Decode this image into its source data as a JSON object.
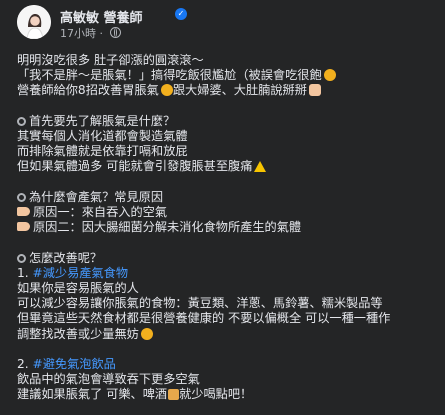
{
  "author": {
    "name": "高敏敏 營養師",
    "verified_icon": "verified-badge-icon",
    "time": "17小時",
    "separator": "·",
    "privacy_icon": "globe-icon"
  },
  "post": {
    "lines": [
      "明明沒吃很多 肚子卻漲的圓滾滾～",
      "「我不是胖～是脹氣！」搞得吃飯很尷尬（被誤會吃很飽",
      "營養師給你8招改善胃脹氣",
      "跟大婦婆、大肚腩說掰掰",
      "首先要先了解脹氣是什麼？",
      "其實每個人消化道都會製造氣體",
      "而排除氣體就是依靠打嗝和放屁",
      "但如果氣體過多 可能就會引發腹脹甚至腹痛",
      "為什麼會產氣？常見原因",
      "原因一：來自吞入的空氣",
      "原因二：因大腸細菌分解未消化食物所產生的氣體",
      "怎麼改善呢？",
      "1. ",
      "#減少易產氣食物",
      "如果你是容易脹氣的人",
      "可以減少容易讓你脹氣的食物：黃豆類、洋蔥、馬鈴薯、糯米製品等",
      "但畢竟這些天然食材都是很營養健康的 不要以偏概全 可以一種一種作",
      "調整找改善或少量無妨",
      "2. ",
      "#避免氣泡飲品",
      "飲品中的氣泡會導致吞下更多空氣",
      "建議如果脹氣了 可樂、啤酒",
      "就少喝點吧！"
    ]
  },
  "icons": {
    "face": "grinning-face-emoji",
    "hand": "waving-hand-emoji",
    "warning": "warning-emoji",
    "point": "pointing-hand-emoji",
    "magnifier": "magnifying-glass-emoji",
    "beer": "beer-mug-emoji"
  }
}
